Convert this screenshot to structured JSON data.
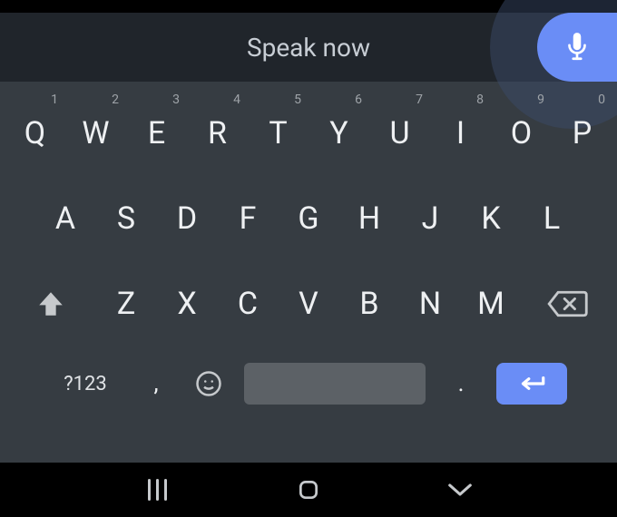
{
  "suggestion": {
    "text": "Speak now"
  },
  "keyboard": {
    "row1": [
      {
        "label": "Q",
        "hint": "1"
      },
      {
        "label": "W",
        "hint": "2"
      },
      {
        "label": "E",
        "hint": "3"
      },
      {
        "label": "R",
        "hint": "4"
      },
      {
        "label": "T",
        "hint": "5"
      },
      {
        "label": "Y",
        "hint": "6"
      },
      {
        "label": "U",
        "hint": "7"
      },
      {
        "label": "I",
        "hint": "8"
      },
      {
        "label": "O",
        "hint": "9"
      },
      {
        "label": "P",
        "hint": "0"
      }
    ],
    "row2": [
      {
        "label": "A"
      },
      {
        "label": "S"
      },
      {
        "label": "D"
      },
      {
        "label": "F"
      },
      {
        "label": "G"
      },
      {
        "label": "H"
      },
      {
        "label": "J"
      },
      {
        "label": "K"
      },
      {
        "label": "L"
      }
    ],
    "row3": [
      {
        "label": "Z"
      },
      {
        "label": "X"
      },
      {
        "label": "C"
      },
      {
        "label": "V"
      },
      {
        "label": "B"
      },
      {
        "label": "N"
      },
      {
        "label": "M"
      }
    ],
    "symbols_label": "?123",
    "comma": ",",
    "period": "."
  },
  "icons": {
    "mic": "mic-icon",
    "shift": "shift-icon",
    "backspace": "backspace-icon",
    "emoji": "emoji-icon",
    "enter": "enter-icon",
    "nav_recents": "recents-icon",
    "nav_home": "home-icon",
    "nav_back": "back-icon"
  },
  "colors": {
    "accent": "#6a8df6",
    "keyboard_bg": "#363c42",
    "suggestion_bg": "#20252b"
  }
}
